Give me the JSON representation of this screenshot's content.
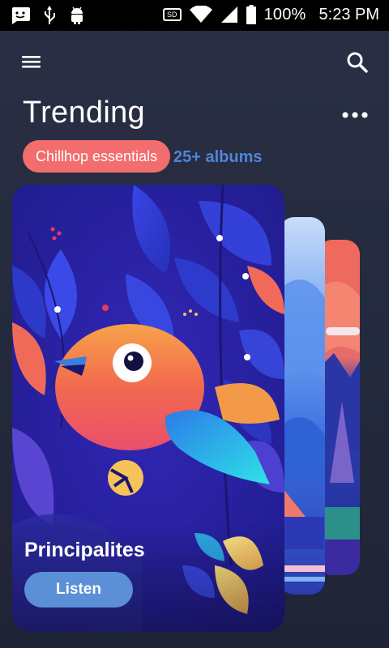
{
  "status_bar": {
    "battery": "100%",
    "time": "5:23 PM",
    "sd_label": "SD",
    "icons": [
      "message-icon",
      "usb-icon",
      "android-icon",
      "sd-card-icon",
      "wifi-icon",
      "signal-icon",
      "battery-icon"
    ]
  },
  "header": {
    "menu_icon": "hamburger-menu-icon",
    "search_icon": "search-icon",
    "title": "Trending",
    "more_icon": "more-horizontal-icon"
  },
  "filter": {
    "chip_label": "Chillhop essentials",
    "count_label": "25+ albums"
  },
  "featured_card": {
    "name": "Principalites",
    "button_label": "Listen"
  },
  "colors": {
    "background": "#262b40",
    "chip": "#f26d6d",
    "accent_blue": "#4f86d6",
    "button": "#5b8fd6"
  }
}
